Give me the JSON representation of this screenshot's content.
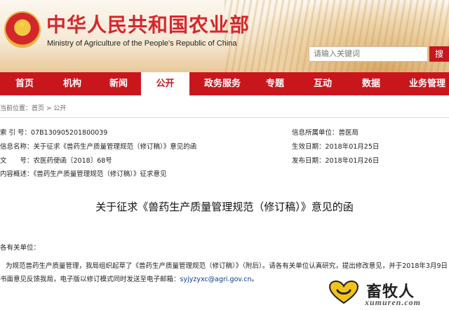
{
  "header": {
    "site_title": "中华人民共和国农业部",
    "site_subtitle": "Ministry of Agriculture of the People's Republic of China",
    "search_placeholder": "请输入关键词",
    "search_button": "搜"
  },
  "nav": {
    "items": [
      {
        "label": "首页"
      },
      {
        "label": "机构"
      },
      {
        "label": "新闻"
      },
      {
        "label": "公开"
      },
      {
        "label": "政务服务"
      },
      {
        "label": "专题"
      },
      {
        "label": "互动"
      },
      {
        "label": "数据"
      },
      {
        "label": "业务管理"
      }
    ],
    "active": "公开"
  },
  "breadcrumb": "当前位置：首页 > 公开",
  "meta": {
    "index_label": "索 引 号：",
    "index_value": "07B130905201800039",
    "name_label": "信息名称：",
    "name_value": "关于征求《兽药生产质量管理规范（修订稿）》意见的函",
    "doc_label": "文　　号：",
    "doc_value": "农医药便函〔2018〕68号",
    "summary_label": "内容概述：",
    "summary_value": "《兽药生产质量管理规范（修订稿）》征求意见",
    "dept_label": "信息所属单位：",
    "dept_value": "兽医局",
    "effective_label": "生效日期：",
    "effective_value": "2018年01月25日",
    "publish_label": "发布日期：",
    "publish_value": "2018年01月26日"
  },
  "article": {
    "title": "关于征求《兽药生产质量管理规范（修订稿）》意见的函",
    "salutation": "各有关单位：",
    "paragraph_line1": "为规范兽药生产质量管理，我局组织起草了《兽药生产质量管理规范（修订稿）》（附后）。请各有关单位认真研究，提出修改意见，并于2018年3月9日",
    "paragraph_line2_prefix": "书面意见反馈我局，电子版以修订模式同时发送至电子邮箱：",
    "email": "syjyzyxc@agri.gov.cn",
    "paragraph_line2_suffix": "。"
  },
  "watermark": {
    "brand": "畜牧人",
    "url": "xumuren.com"
  },
  "colors": {
    "brand_red": "#c9161d",
    "title_red": "#d8262b"
  }
}
